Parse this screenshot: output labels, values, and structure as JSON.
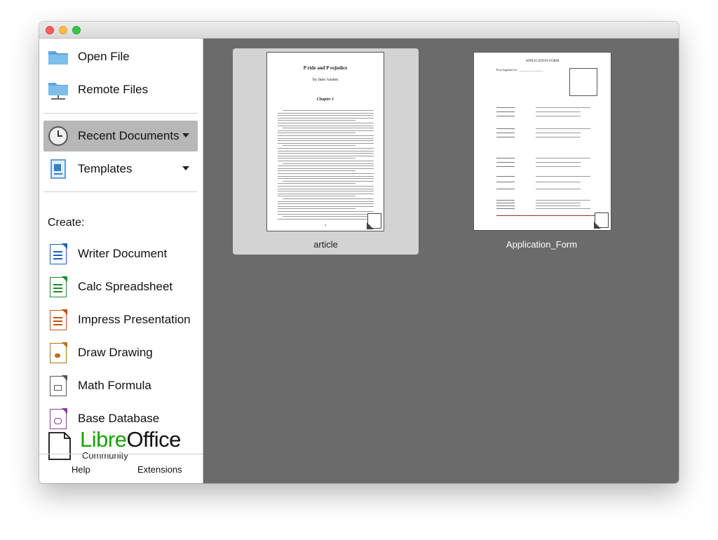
{
  "sidebar": {
    "open_file": "Open File",
    "remote_files": "Remote Files",
    "recent_documents": "Recent Documents",
    "templates": "Templates",
    "create_label": "Create:",
    "create_items": [
      {
        "label": "Writer Document",
        "icon": "writer-document-icon",
        "color": "#1b5fb5"
      },
      {
        "label": "Calc Spreadsheet",
        "icon": "calc-spreadsheet-icon",
        "color": "#1f8a2a"
      },
      {
        "label": "Impress Presentation",
        "icon": "impress-presentation-icon",
        "color": "#c0531a"
      },
      {
        "label": "Draw Drawing",
        "icon": "draw-drawing-icon",
        "color": "#b7701a"
      },
      {
        "label": "Math Formula",
        "icon": "math-formula-icon",
        "color": "#555555"
      },
      {
        "label": "Base Database",
        "icon": "base-database-icon",
        "color": "#8a3a99"
      }
    ],
    "logo": {
      "libre": "Libre",
      "office": "Office",
      "sub": "Community"
    },
    "footer": {
      "help": "Help",
      "extensions": "Extensions"
    }
  },
  "recent": [
    {
      "name": "article",
      "title": "P ride and P rejudice",
      "author": "by Jane Austen",
      "chapter": "Chapter 1",
      "page_number": "1"
    },
    {
      "name": "Application_Form",
      "title": "APPLICATION FORM",
      "post_applied": "Post Applied for : _______________"
    }
  ],
  "colors": {
    "accent_green": "#18a303",
    "content_bg": "#6b6b6b",
    "active_item": "#b7b7b7"
  }
}
